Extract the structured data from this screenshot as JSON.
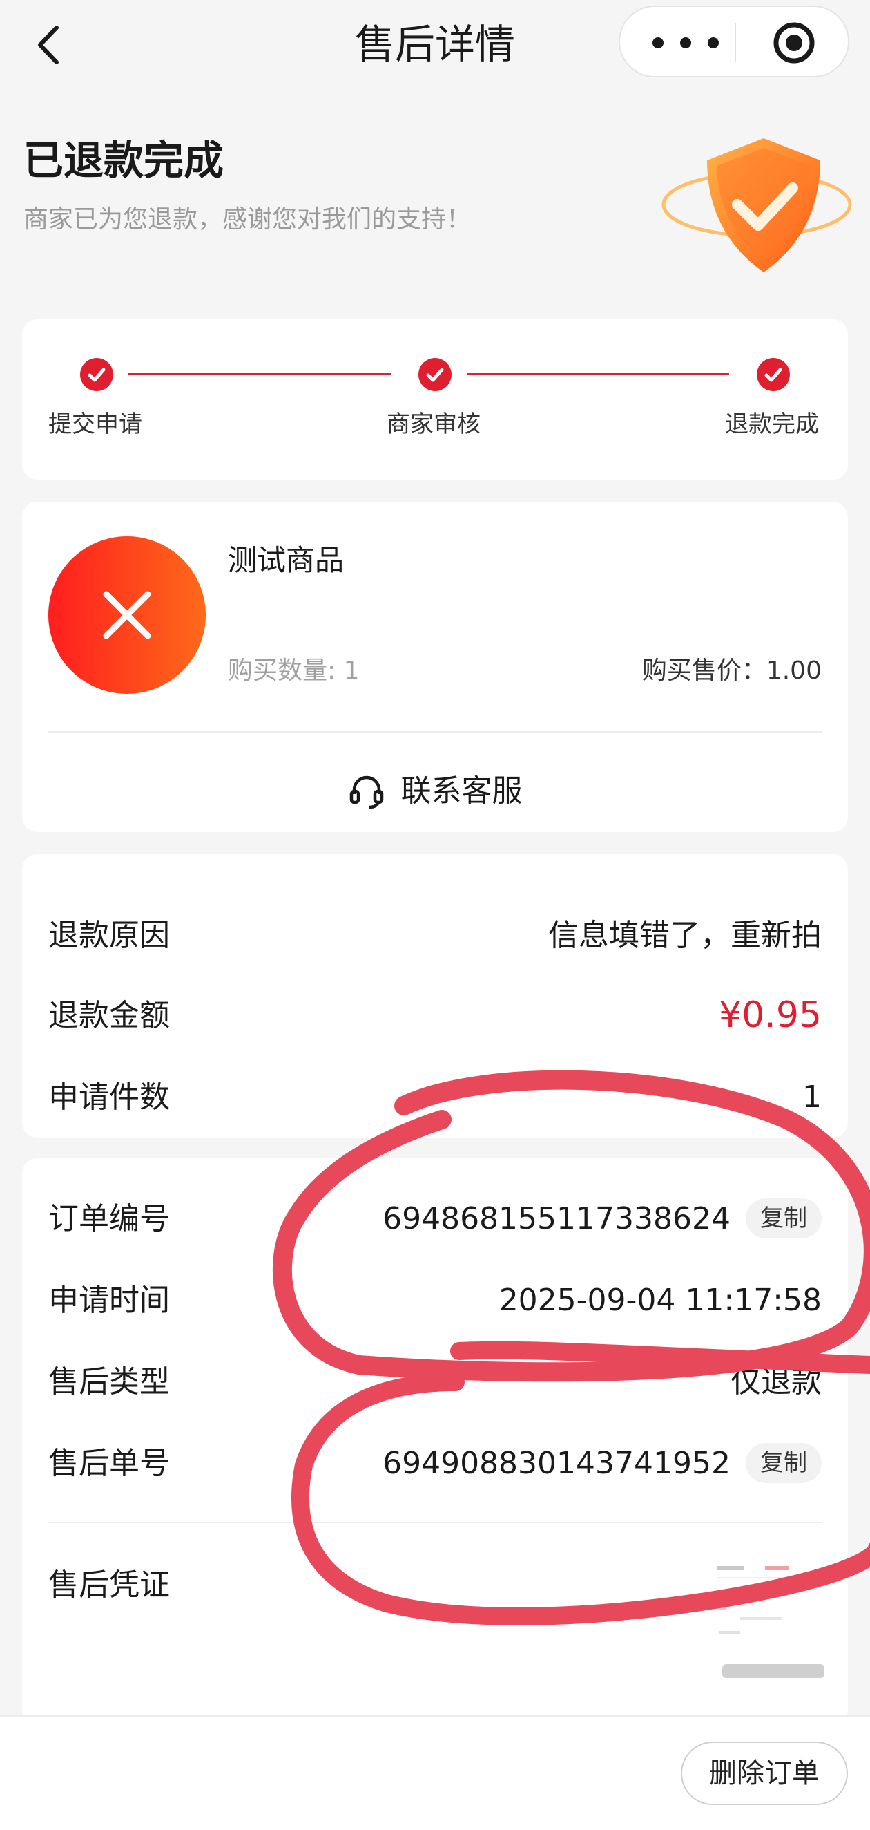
{
  "nav": {
    "title": "售后详情"
  },
  "status": {
    "title": "已退款完成",
    "subtitle": "商家已为您退款，感谢您对我们的支持！"
  },
  "steps": [
    {
      "label": "提交申请"
    },
    {
      "label": "商家审核"
    },
    {
      "label": "退款完成"
    }
  ],
  "product": {
    "name": "测试商品",
    "quantity_text": "购买数量: 1",
    "price_text": "购买售价：1.00",
    "contact_label": "联系客服"
  },
  "refund": {
    "reason_label": "退款原因",
    "reason_value": "信息填错了，重新拍",
    "amount_label": "退款金额",
    "amount_value": "¥0.95",
    "count_label": "申请件数",
    "count_value": "1"
  },
  "order": {
    "order_no_label": "订单编号",
    "order_no_value": "694868155117338624",
    "copy_label": "复制",
    "apply_time_label": "申请时间",
    "apply_time_value": "2025-09-04 11:17:58",
    "type_label": "售后类型",
    "type_value": "仅退款",
    "aftersale_no_label": "售后单号",
    "aftersale_no_value": "694908830143741952",
    "evidence_label": "售后凭证"
  },
  "footer": {
    "delete_label": "删除订单"
  },
  "colors": {
    "accent": "#df1f30",
    "scribble": "#e8495a",
    "orange": "#ff5a14"
  }
}
